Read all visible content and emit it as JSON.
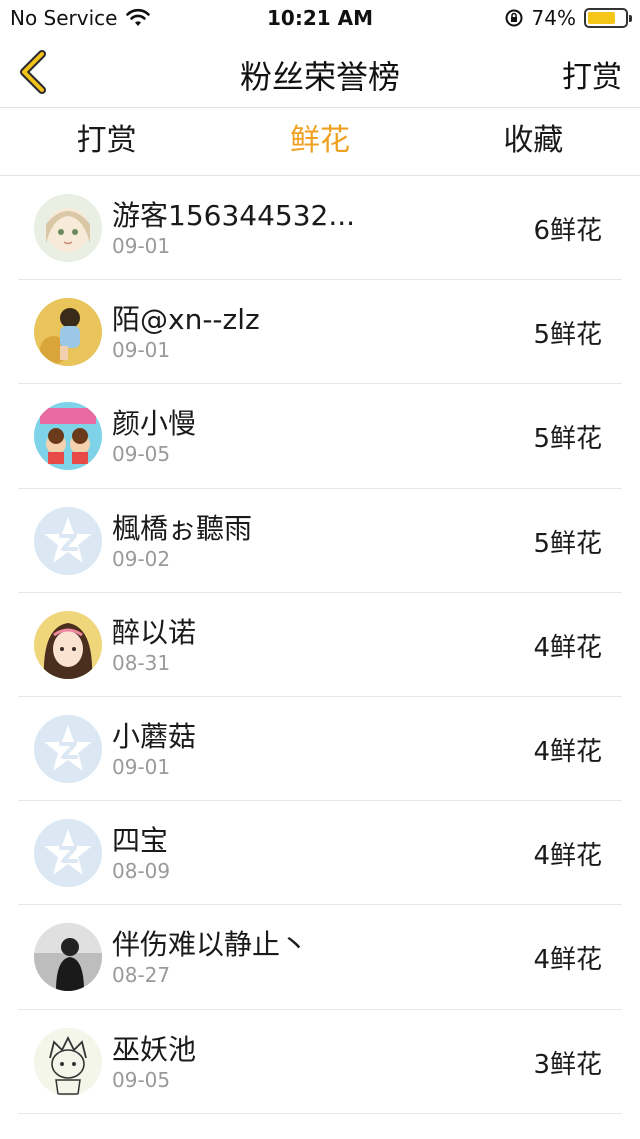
{
  "status": {
    "carrier": "No Service",
    "time": "10:21 AM",
    "battery": "74%",
    "battery_level": 0.74
  },
  "nav": {
    "title": "粉丝荣誉榜",
    "right_label": "打赏",
    "back_icon": "chevron-left-icon",
    "accent": "#f0a020"
  },
  "tabs": [
    {
      "label": "打赏",
      "active": false
    },
    {
      "label": "鲜花",
      "active": true
    },
    {
      "label": "收藏",
      "active": false
    }
  ],
  "fans": [
    {
      "name": "游客156344532...",
      "date": "09-01",
      "count": "6鲜花",
      "avatar": "anime-girl"
    },
    {
      "name": "陌@xn--zlz",
      "date": "09-01",
      "count": "5鲜花",
      "avatar": "photo-boy"
    },
    {
      "name": "颜小慢",
      "date": "09-05",
      "count": "5鲜花",
      "avatar": "cartoon"
    },
    {
      "name": "楓橋ぉ聽雨",
      "date": "09-02",
      "count": "5鲜花",
      "avatar": "default"
    },
    {
      "name": "醉以诺",
      "date": "08-31",
      "count": "4鲜花",
      "avatar": "girl"
    },
    {
      "name": "小蘑菇",
      "date": "09-01",
      "count": "4鲜花",
      "avatar": "default"
    },
    {
      "name": "四宝",
      "date": "08-09",
      "count": "4鲜花",
      "avatar": "default"
    },
    {
      "name": "伴伤难以静止丶",
      "date": "08-27",
      "count": "4鲜花",
      "avatar": "photo-dark"
    },
    {
      "name": "巫妖池",
      "date": "09-05",
      "count": "3鲜花",
      "avatar": "sketch"
    }
  ]
}
